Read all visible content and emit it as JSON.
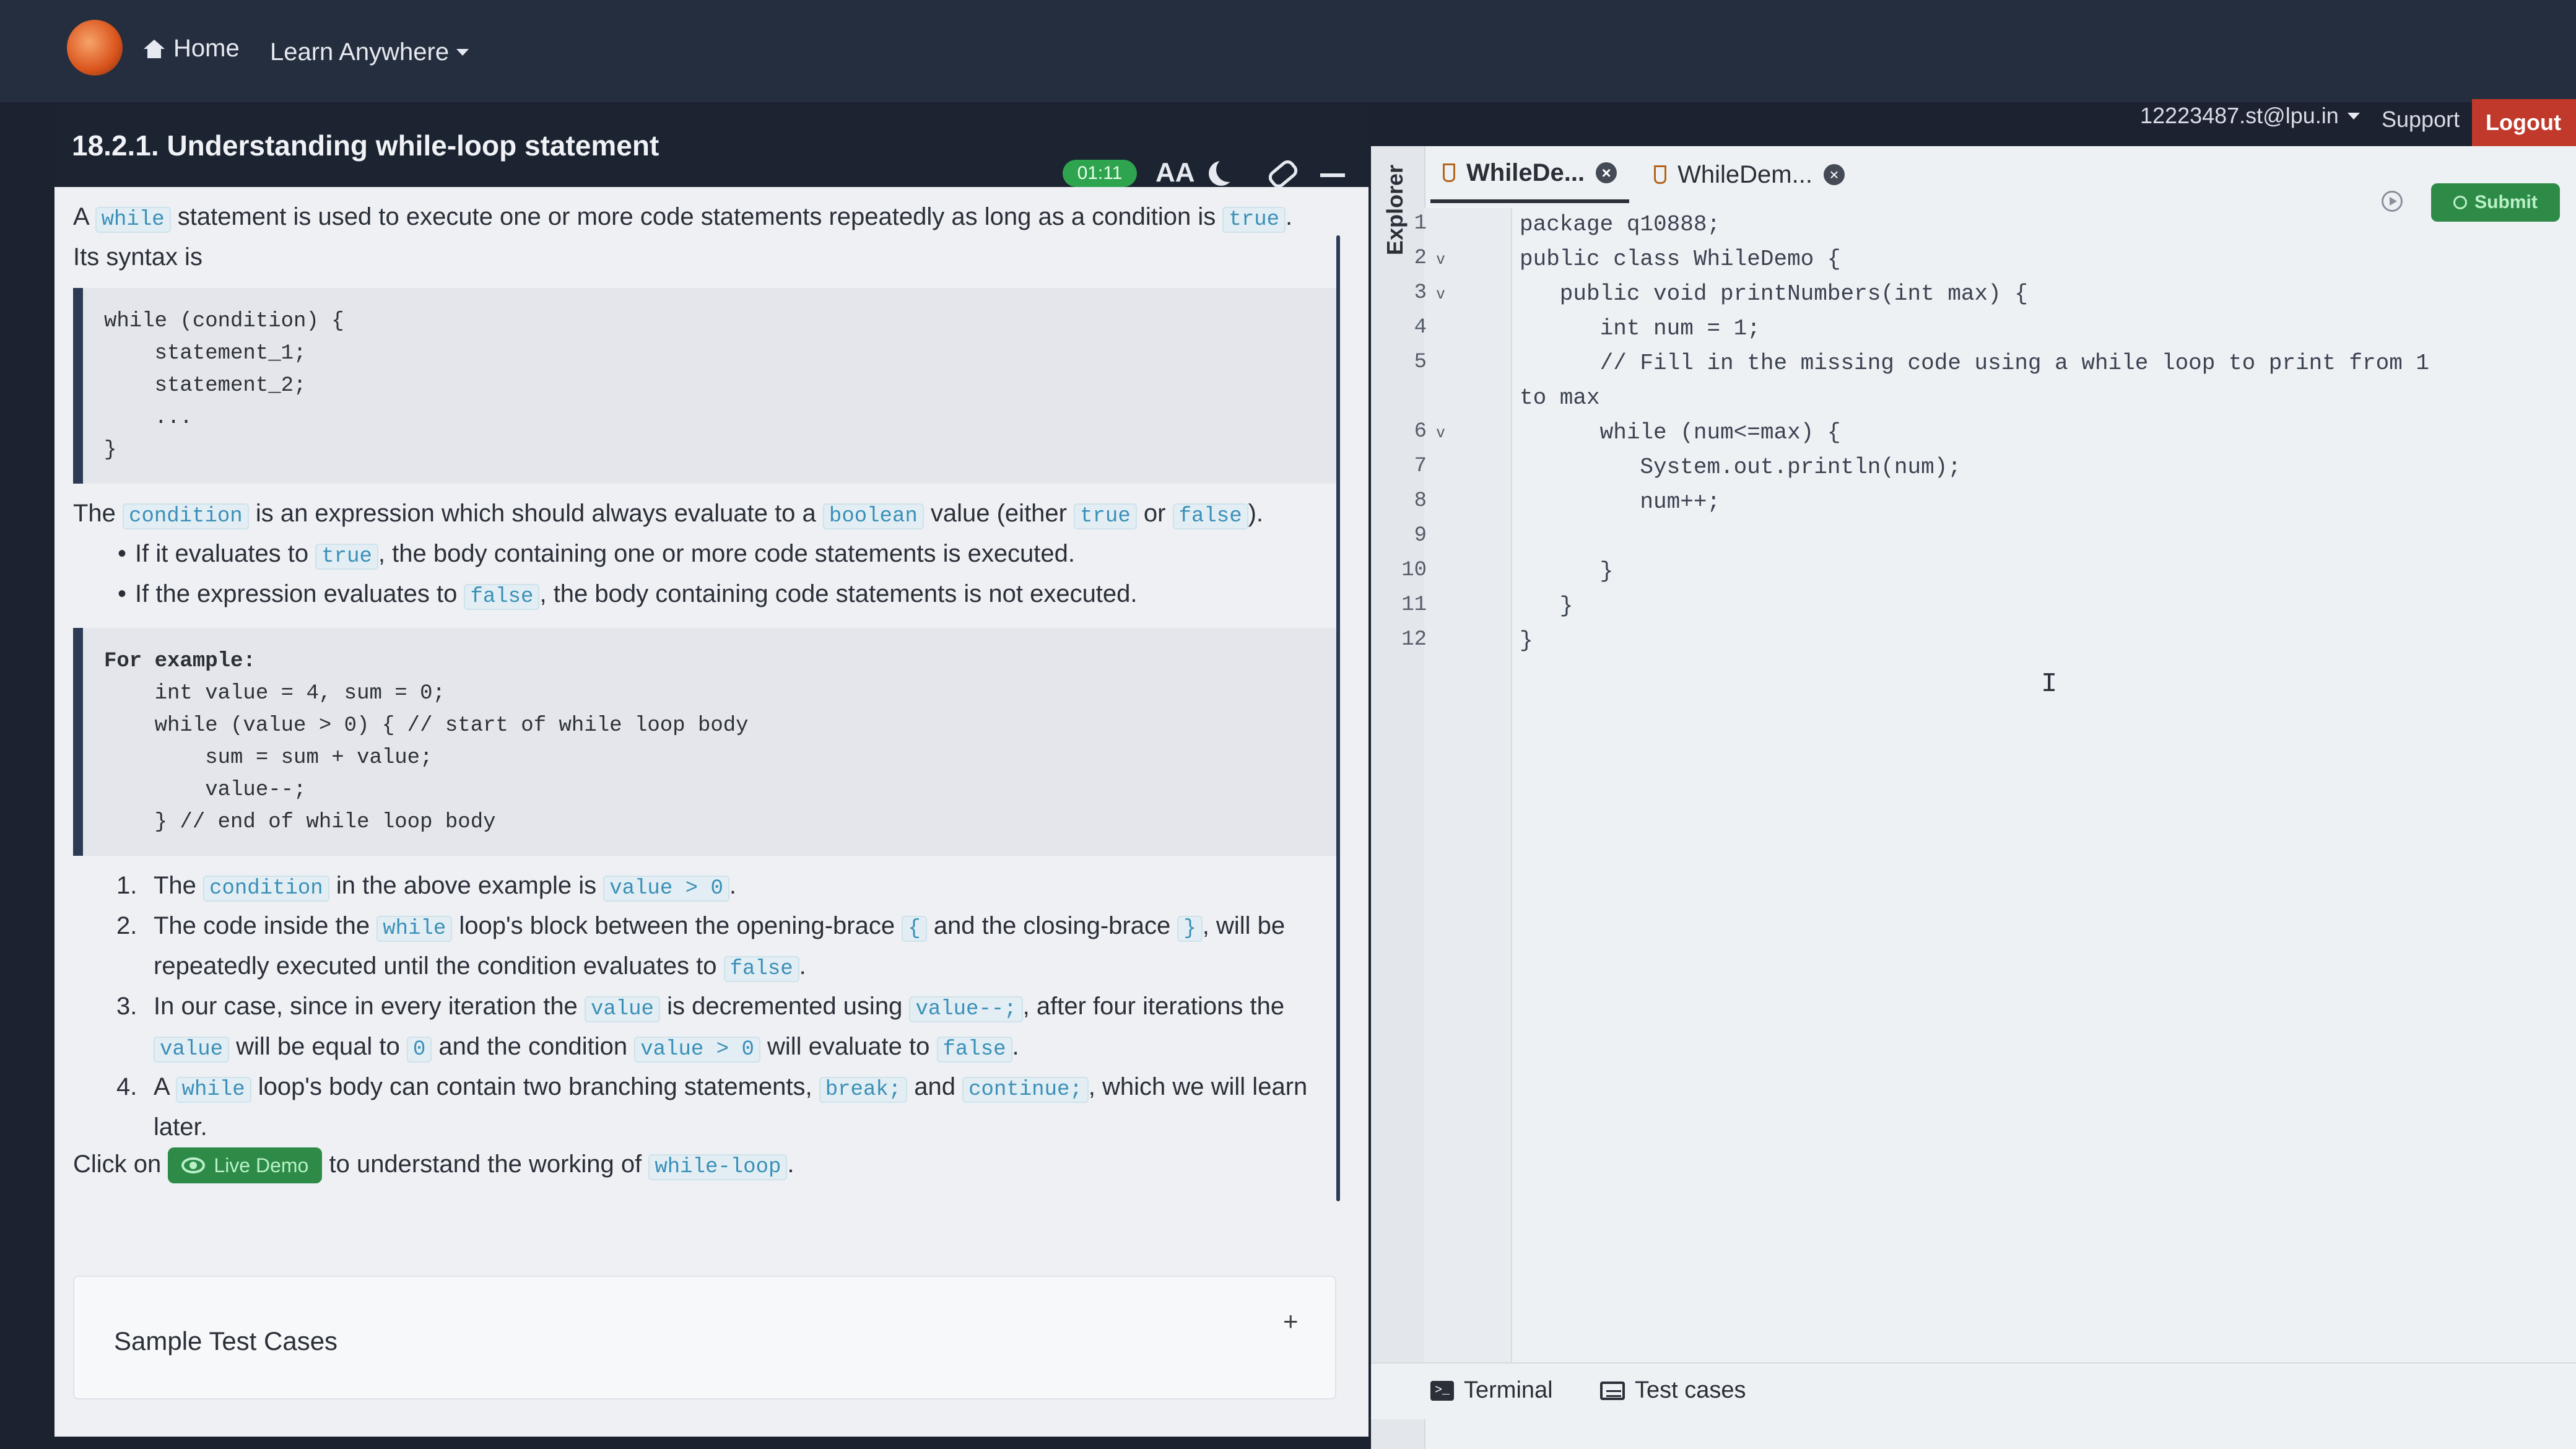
{
  "nav": {
    "home_label": "Home",
    "learn_label": "Learn Anywhere",
    "user_email": "12223487.st@lpu.in",
    "support_label": "Support",
    "logout_label": "Logout"
  },
  "problem": {
    "title": "18.2.1. Understanding while-loop statement",
    "timer": "01:11",
    "font_toggle_label": "AA",
    "intro": {
      "t1": "A",
      "c1": "while",
      "t2": "statement is used to execute one or more code statements repeatedly as long as a condition is",
      "c2": "true",
      "t3": "."
    },
    "syntax_label": "Its syntax is",
    "syntax_code": [
      "while (condition) {",
      "    statement_1;",
      "    statement_2;",
      "    ...",
      "}"
    ],
    "cond_para": {
      "t1": "The",
      "c1": "condition",
      "t2": "is an expression which should always evaluate to a",
      "c2": "boolean",
      "t3": "value (either",
      "c3": "true",
      "t4": "or",
      "c4": "false",
      "t5": ")."
    },
    "bullets": [
      {
        "pre": "If it evaluates to",
        "code": "true",
        "post": ", the body containing one or more code statements is executed."
      },
      {
        "pre": "If the expression evaluates to",
        "code": "false",
        "post": ", the body containing code statements is not executed."
      }
    ],
    "example_code": [
      "For example:",
      "    int value = 4, sum = 0;",
      "    while (value > 0) { // start of while loop body",
      "        sum = sum + value;",
      "        value--;",
      "    } // end of while loop body"
    ],
    "list": {
      "i1": {
        "n": "1.",
        "t1": "The",
        "c1": "condition",
        "t2": "in the above example is",
        "c2": "value > 0",
        "t3": "."
      },
      "i2": {
        "n": "2.",
        "t1": "The code inside the",
        "c1": "while",
        "t2": "loop's block between the opening-brace",
        "c2": "{",
        "t3": "and the closing-brace",
        "c3": "}",
        "t4": ", will be repeatedly executed until the condition evaluates to",
        "c4": "false",
        "t5": "."
      },
      "i3": {
        "n": "3.",
        "t1": "In our case, since in every iteration the",
        "c1": "value",
        "t2": "is decremented using",
        "c2": "value--;",
        "t3": ", after four iterations the",
        "c3": "value",
        "t4": "will be equal to",
        "c4": "0",
        "t5": "and the condition",
        "c5": "value > 0",
        "t6": "will evaluate to",
        "c6": "false",
        "t7": "."
      },
      "i4": {
        "n": "4.",
        "t1": "A",
        "c1": "while",
        "t2": "loop's body can contain two branching statements,",
        "c2": "break;",
        "t3": "and",
        "c3": "continue;",
        "t4": ", which we will learn later."
      }
    },
    "demo": {
      "pre": "Click on",
      "button": "Live Demo",
      "post": "to understand the working of",
      "code": "while-loop",
      "end": "."
    },
    "sample_title": "Sample Test Cases",
    "sample_toggle": "+"
  },
  "editor": {
    "explorer_label": "Explorer",
    "tabs": [
      {
        "label": "WhileDe..."
      },
      {
        "label": "WhileDem..."
      }
    ],
    "submit_label": "Submit",
    "lines": [
      {
        "n": "1",
        "fold": "",
        "text": "package q10888;"
      },
      {
        "n": "2",
        "fold": "v",
        "text": "public class WhileDemo {"
      },
      {
        "n": "3",
        "fold": "v",
        "text": "   public void printNumbers(int max) {"
      },
      {
        "n": "4",
        "fold": "",
        "text": "      int num = 1;"
      },
      {
        "n": "5",
        "fold": "",
        "text": "      // Fill in the missing code using a while loop to print from 1"
      },
      {
        "n": "",
        "fold": "",
        "text": "to max"
      },
      {
        "n": "6",
        "fold": "v",
        "text": "      while (num<=max) {"
      },
      {
        "n": "7",
        "fold": "",
        "text": "         System.out.println(num);"
      },
      {
        "n": "8",
        "fold": "",
        "text": "         num++;"
      },
      {
        "n": "9",
        "fold": "",
        "text": ""
      },
      {
        "n": "10",
        "fold": "",
        "text": "      }"
      },
      {
        "n": "11",
        "fold": "",
        "text": "   }"
      },
      {
        "n": "12",
        "fold": "",
        "text": "}"
      }
    ],
    "cursor": "I",
    "bottom": {
      "terminal_label": "Terminal",
      "testcases_label": "Test cases"
    }
  }
}
